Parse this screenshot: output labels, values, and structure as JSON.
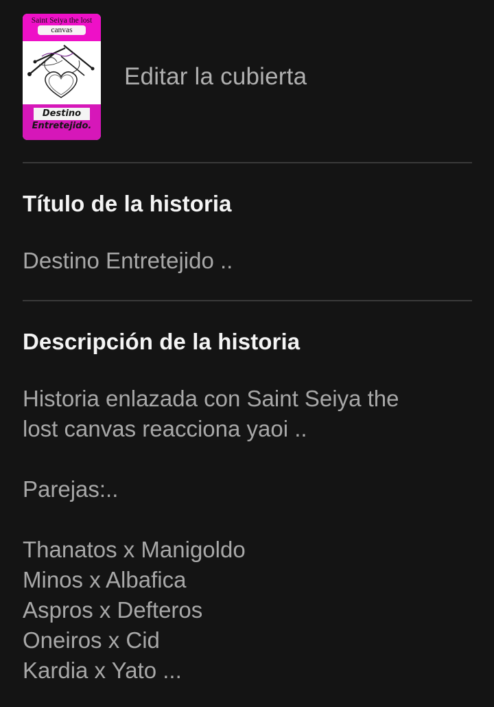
{
  "cover": {
    "edit_label": "Editar la cubierta",
    "art_top_line1": "Saint Seiya the lost",
    "art_top_line2": "canvas",
    "art_bottom_line1": "Destino",
    "art_bottom_line2": "Entretejido.",
    "colors": {
      "magenta": "#ee10c7",
      "magenta_dark": "#d617b9"
    }
  },
  "title_section": {
    "heading": "Título de la historia",
    "value": "Destino Entretejido .."
  },
  "description_section": {
    "heading": "Descripción de la historia",
    "value": "Historia enlazada con Saint Seiya the\nlost canvas reacciona yaoi ..\n\nParejas:..\n\nThanatos x Manigoldo\nMinos x Albafica\nAspros x Defteros\nOneiros x Cid\nKardia x Yato ..."
  },
  "theme": {
    "background": "#141414",
    "heading_color": "#f4f4f4",
    "value_color": "#a8a8a8",
    "divider_color": "#3a3a3a"
  }
}
